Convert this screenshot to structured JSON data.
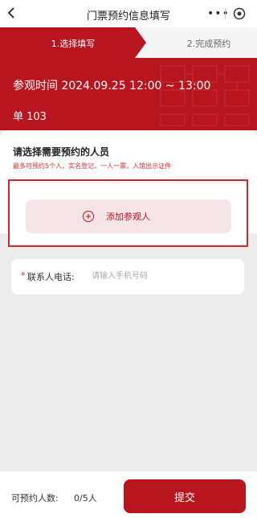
{
  "nav": {
    "title": "门票预约信息填写",
    "more_glyph": "•••"
  },
  "steps": {
    "step1": "1.选择填写",
    "step2": "2.完成预约"
  },
  "booking": {
    "time": "参观时间 2024.09.25 12:00 ~ 13:00",
    "hall": "单 103"
  },
  "attendees": {
    "title": "请选择需要预约的人员",
    "note": "最多可预约5个人，实名登记，一人一票，入馆出示证件",
    "add_label": "添加参观人"
  },
  "contact": {
    "required_mark": "*",
    "label": "联系人电话:",
    "placeholder": "请输入手机号码"
  },
  "footer": {
    "count_label": "可预约人数:",
    "count_value": "0/5人",
    "submit_label": "提交"
  },
  "colors": {
    "brand": "#b8151f",
    "highlight_border": "#d4252c",
    "add_button_bg": "#f6e4e6"
  }
}
